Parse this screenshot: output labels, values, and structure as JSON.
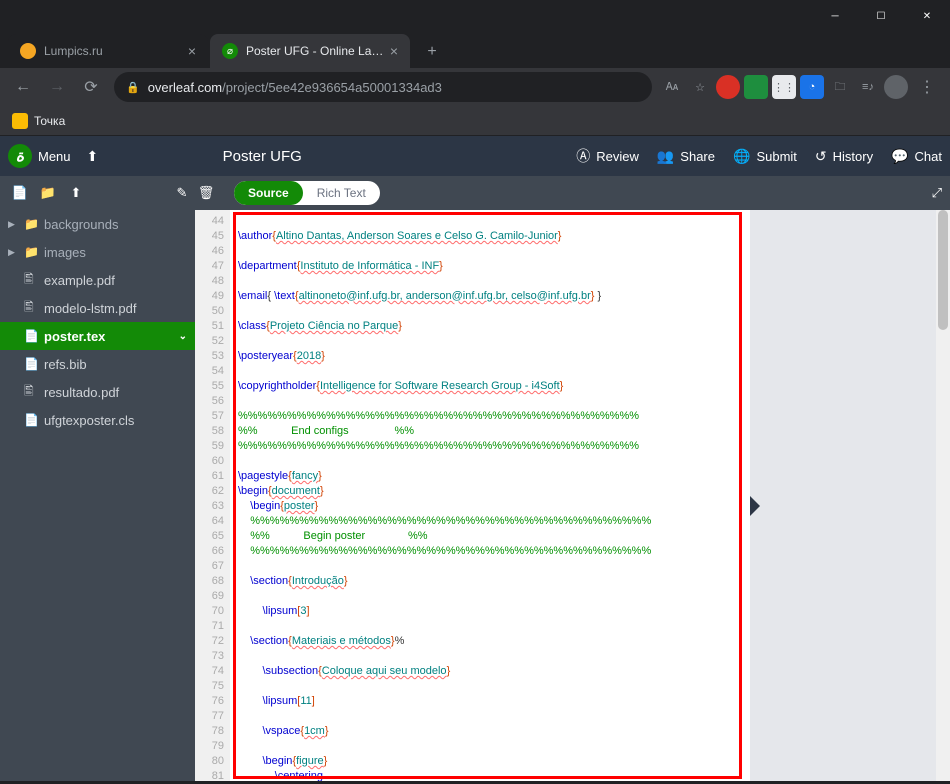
{
  "window": {
    "title": "Poster UFG - Online LaTeX Editor"
  },
  "tabs": [
    {
      "label": "Lumpics.ru",
      "favicon_bg": "#f5a623",
      "active": false
    },
    {
      "label": "Poster UFG - Online LaTeX Editor",
      "favicon_bg": "#138a07",
      "active": true
    }
  ],
  "url": {
    "domain": "overleaf.com",
    "path": "/project/5ee42e936654a50001334ad3"
  },
  "bookmark": {
    "label": "Точка"
  },
  "overleaf": {
    "menu_label": "Menu",
    "project_title": "Poster UFG",
    "actions": {
      "review": "Review",
      "share": "Share",
      "submit": "Submit",
      "history": "History",
      "chat": "Chat"
    },
    "editor_modes": {
      "source": "Source",
      "rich": "Rich Text"
    }
  },
  "file_tree": [
    {
      "type": "folder",
      "label": "backgrounds"
    },
    {
      "type": "folder",
      "label": "images"
    },
    {
      "type": "file",
      "icon": "pdf",
      "label": "example.pdf"
    },
    {
      "type": "file",
      "icon": "pdf",
      "label": "modelo-lstm.pdf"
    },
    {
      "type": "file",
      "icon": "tex",
      "label": "poster.tex",
      "active": true
    },
    {
      "type": "file",
      "icon": "bib",
      "label": "refs.bib"
    },
    {
      "type": "file",
      "icon": "pdf",
      "label": "resultado.pdf"
    },
    {
      "type": "file",
      "icon": "cls",
      "label": "ufgtexposter.cls"
    }
  ],
  "code_lines": [
    {
      "n": 44,
      "t": ""
    },
    {
      "n": 45,
      "t": "\\author{Altino Dantas, Anderson Soares e Celso G. Camilo-Junior}"
    },
    {
      "n": 46,
      "t": ""
    },
    {
      "n": 47,
      "t": "\\department{Instituto de Informática - INF}"
    },
    {
      "n": 48,
      "t": ""
    },
    {
      "n": 49,
      "t": "\\email{ \\text{altinoneto@inf.ufg.br, anderson@inf.ufg.br, celso@inf.ufg.br} }"
    },
    {
      "n": 50,
      "t": ""
    },
    {
      "n": 51,
      "t": "\\class{Projeto Ciência no Parque}"
    },
    {
      "n": 52,
      "t": ""
    },
    {
      "n": 53,
      "t": "\\posteryear{2018}"
    },
    {
      "n": 54,
      "t": ""
    },
    {
      "n": 55,
      "t": "\\copyrightholder{Intelligence for Software Research Group - i4Soft}"
    },
    {
      "n": 56,
      "t": ""
    },
    {
      "n": 57,
      "t": "%%%%%%%%%%%%%%%%%%%%%%%%%%%%%%%%%%%%%%%%%"
    },
    {
      "n": 58,
      "t": "%%           End configs               %%"
    },
    {
      "n": 59,
      "t": "%%%%%%%%%%%%%%%%%%%%%%%%%%%%%%%%%%%%%%%%%"
    },
    {
      "n": 60,
      "t": ""
    },
    {
      "n": 61,
      "t": "\\pagestyle{fancy}"
    },
    {
      "n": 62,
      "t": "\\begin{document}"
    },
    {
      "n": 63,
      "t": "    \\begin{poster}"
    },
    {
      "n": 64,
      "t": "    %%%%%%%%%%%%%%%%%%%%%%%%%%%%%%%%%%%%%%%%%"
    },
    {
      "n": 65,
      "t": "    %%           Begin poster              %%"
    },
    {
      "n": 66,
      "t": "    %%%%%%%%%%%%%%%%%%%%%%%%%%%%%%%%%%%%%%%%%"
    },
    {
      "n": 67,
      "t": ""
    },
    {
      "n": 68,
      "t": "    \\section{Introdução}"
    },
    {
      "n": 69,
      "t": ""
    },
    {
      "n": 70,
      "t": "        \\lipsum[3]"
    },
    {
      "n": 71,
      "t": ""
    },
    {
      "n": 72,
      "t": "    \\section{Materiais e métodos}%"
    },
    {
      "n": 73,
      "t": ""
    },
    {
      "n": 74,
      "t": "        \\subsection{Coloque aqui seu modelo}"
    },
    {
      "n": 75,
      "t": ""
    },
    {
      "n": 76,
      "t": "        \\lipsum[11]"
    },
    {
      "n": 77,
      "t": ""
    },
    {
      "n": 78,
      "t": "        \\vspace{1cm}"
    },
    {
      "n": 79,
      "t": ""
    },
    {
      "n": 80,
      "t": "        \\begin{figure}"
    },
    {
      "n": 81,
      "t": "            \\centering"
    }
  ]
}
